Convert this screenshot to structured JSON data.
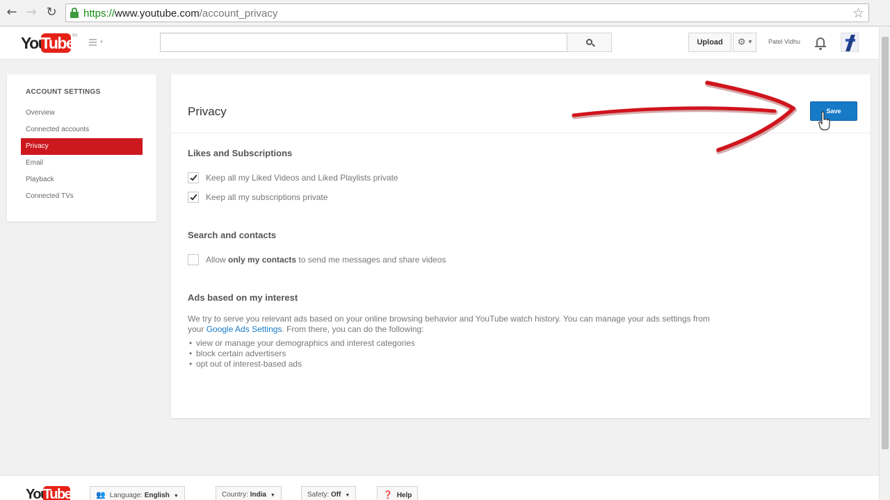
{
  "browser": {
    "url_scheme": "https://",
    "url_host": "www.youtube.com",
    "url_path": "/account_privacy"
  },
  "masthead": {
    "logo_you": "You",
    "logo_tube": "Tube",
    "logo_region": "IN",
    "upload_label": "Upload",
    "username": "Patel Vidhu"
  },
  "sidebar": {
    "heading": "ACCOUNT SETTINGS",
    "items": [
      {
        "label": "Overview"
      },
      {
        "label": "Connected accounts"
      },
      {
        "label": "Privacy"
      },
      {
        "label": "Email"
      },
      {
        "label": "Playback"
      },
      {
        "label": "Connected TVs"
      }
    ]
  },
  "privacy": {
    "title": "Privacy",
    "save_label": "Save",
    "likes_section": {
      "title": "Likes and Subscriptions",
      "options": [
        {
          "label": "Keep all my Liked Videos and Liked Playlists private",
          "checked": true
        },
        {
          "label": "Keep all my subscriptions private",
          "checked": true
        }
      ]
    },
    "search_section": {
      "title": "Search and contacts",
      "option": {
        "prefix": "Allow ",
        "bold": "only my contacts",
        "suffix": " to send me messages and share videos",
        "checked": false
      }
    },
    "ads_section": {
      "title": "Ads based on my interest",
      "text_before": "We try to serve you relevant ads based on your online browsing behavior and YouTube watch history. You can manage your ads settings from your ",
      "link": "Google Ads Settings",
      "text_after": ". From there, you can do the following:",
      "list": [
        "view or manage your demographics and interest categories",
        "block certain advertisers",
        "opt out of interest-based ads"
      ]
    }
  },
  "footer": {
    "logo_you": "You",
    "logo_tube": "Tube",
    "language_label": "Language: ",
    "language_value": "English",
    "country_label": "Country: ",
    "country_value": "India",
    "safety_label": "Safety: ",
    "safety_value": "Off",
    "help_label": "Help"
  },
  "colors": {
    "accent_red": "#cc181e",
    "save_blue": "#167ac6",
    "annotation_red": "#d0141c"
  }
}
